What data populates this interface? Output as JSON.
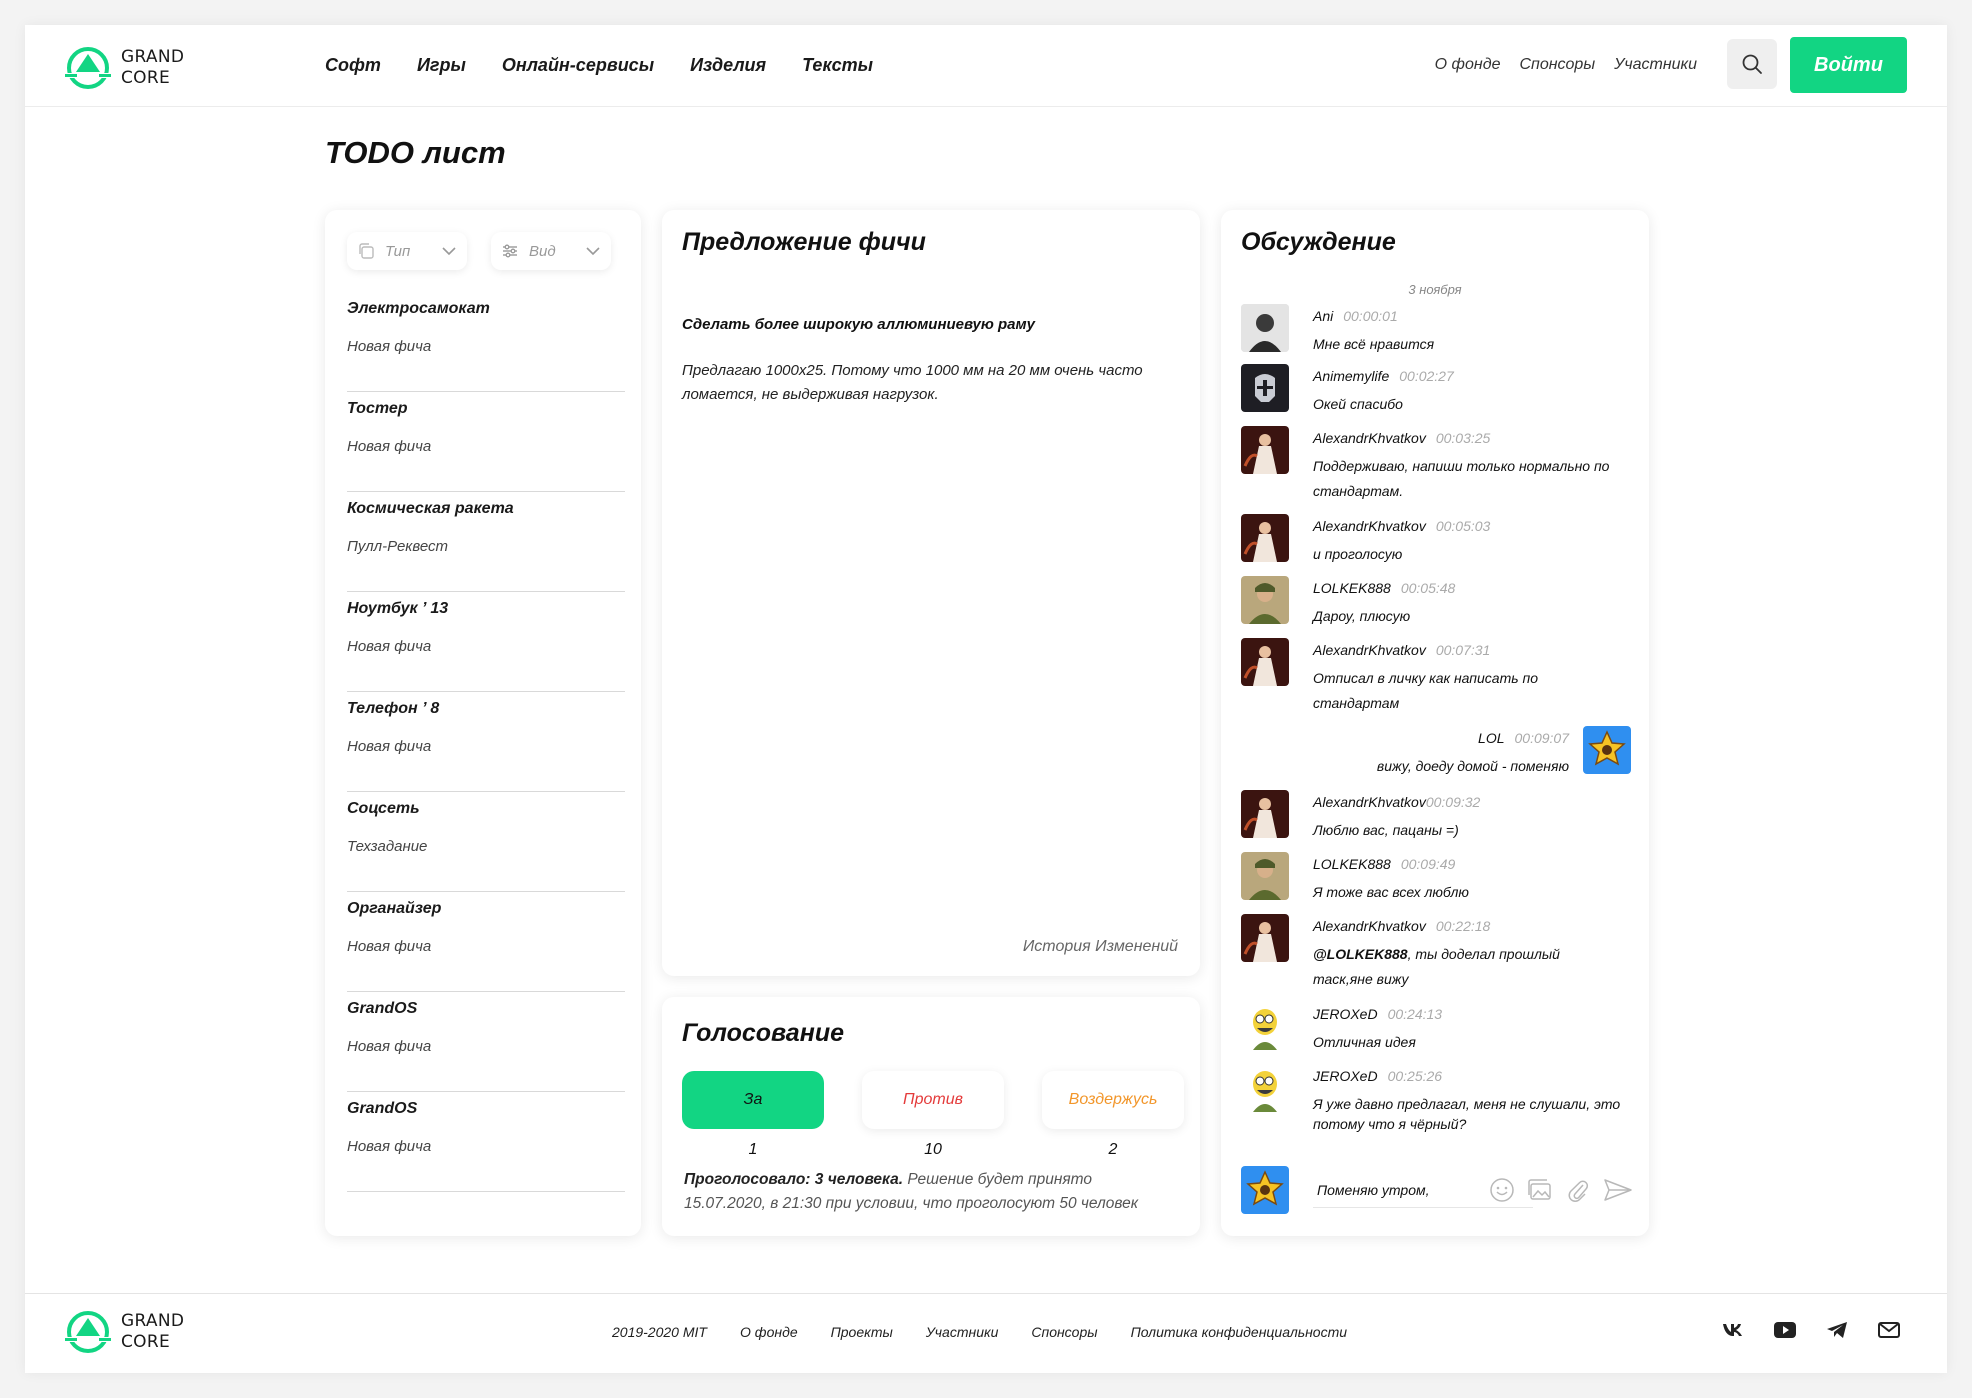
{
  "brand": {
    "line1": "GRAND",
    "line2": "CORE",
    "accent": "#12d583"
  },
  "header": {
    "nav_main": [
      "Софт",
      "Игры",
      "Онлайн-сервисы",
      "Изделия",
      "Тексты"
    ],
    "nav_secondary": [
      "О фонде",
      "Спонсоры",
      "Участники"
    ],
    "search_icon": "search-icon",
    "login_label": "Войти"
  },
  "page": {
    "title": "TODO лист"
  },
  "filters": {
    "type": {
      "label": "Тип",
      "icon": "copy-icon"
    },
    "view": {
      "label": "Вид",
      "icon": "sliders-icon"
    }
  },
  "tasks": [
    {
      "title": "Электросамокат",
      "status": "Новая фича"
    },
    {
      "title": "Тостер",
      "status": "Новая фича"
    },
    {
      "title": "Космическая ракета",
      "status": "Пулл-Реквест"
    },
    {
      "title": "Ноутбук ’ 13",
      "status": "Новая фича"
    },
    {
      "title": "Телефон ’ 8",
      "status": "Новая фича"
    },
    {
      "title": "Соцсеть",
      "status": "Техзадание"
    },
    {
      "title": "Органайзер",
      "status": "Новая фича"
    },
    {
      "title": "GrandOS",
      "status": "Новая фича"
    },
    {
      "title": "GrandOS",
      "status": "Новая фича"
    }
  ],
  "feature": {
    "heading": "Предложение фичи",
    "subtitle": "Сделать более широкую аллюминиевую раму",
    "text": "Предлагаю 1000х25. Потому что 1000 мм на 20 мм очень часто ломается, не выдерживая нагрузок.",
    "history_link": "История Изменений"
  },
  "voting": {
    "heading": "Голосование",
    "for": {
      "label": "За",
      "count": "1"
    },
    "against": {
      "label": "Против",
      "count": "10"
    },
    "abstain": {
      "label": "Воздержусь",
      "count": "2"
    },
    "info_bold": "Проголосовало: 3 человека.",
    "info_rest": " Решение будет принято 15.07.2020, в 21:30 при условии, что проголосуют 50 человек"
  },
  "discussion": {
    "heading": "Обсуждение",
    "date": "3 ноября",
    "messages": [
      {
        "author": "Ani",
        "time": "00:00:01",
        "text": "Мне всё нравится",
        "avatar": "portrait"
      },
      {
        "author": "Animemylife",
        "time": "00:02:27",
        "text": "Окей спасибо",
        "avatar": "helmet"
      },
      {
        "author": "AlexandrKhvatkov",
        "time": "00:03:25",
        "text": "Поддерживаю, напиши только нормально по стандартам.",
        "avatar": "wizard"
      },
      {
        "author": "AlexandrKhvatkov",
        "time": "00:05:03",
        "text": "и проголосую",
        "avatar": "wizard"
      },
      {
        "author": "LOLKEK888",
        "time": "00:05:48",
        "text": "Дароу, плюсую",
        "avatar": "soldier"
      },
      {
        "author": "AlexandrKhvatkov",
        "time": "00:07:31",
        "text": "Отписал в личку как написать по стандартам",
        "avatar": "wizard"
      },
      {
        "author": "LOL",
        "time": "00:09:07",
        "text": "вижу, доеду домой - поменяю",
        "avatar": "badge",
        "own": true
      },
      {
        "author": "AlexandrKhvatkov",
        "time": "00:09:32",
        "text": "Люблю вас, пацаны =)",
        "avatar": "wizard"
      },
      {
        "author": "LOLKEK888",
        "time": "00:09:49",
        "text": "Я тоже вас всех люблю",
        "avatar": "soldier"
      },
      {
        "author": "AlexandrKhvatkov",
        "time": "00:22:18",
        "mention": "@LOLKEK888",
        "text": ", ты доделал прошлый таск,яне вижу",
        "avatar": "wizard"
      },
      {
        "author": "JEROXeD",
        "time": "00:24:13",
        "text": "Отличная идея",
        "avatar": "cartoon"
      },
      {
        "author": "JEROXeD",
        "time": "00:25:26",
        "text": "Я уже давно предлагал, меня не слушали, это потому что я чёрный?",
        "avatar": "cartoon"
      }
    ],
    "input_value": "Поменяю утром,",
    "input_icons": [
      "emoji-icon",
      "image-icon",
      "attach-icon",
      "send-icon"
    ]
  },
  "footer": {
    "links": [
      "2019-2020 MIT",
      "О фонде",
      "Проекты",
      "Участники",
      "Спонсоры",
      "Политика конфиденциальности"
    ],
    "socials": [
      "vk-icon",
      "youtube-icon",
      "telegram-icon",
      "mail-icon"
    ]
  }
}
